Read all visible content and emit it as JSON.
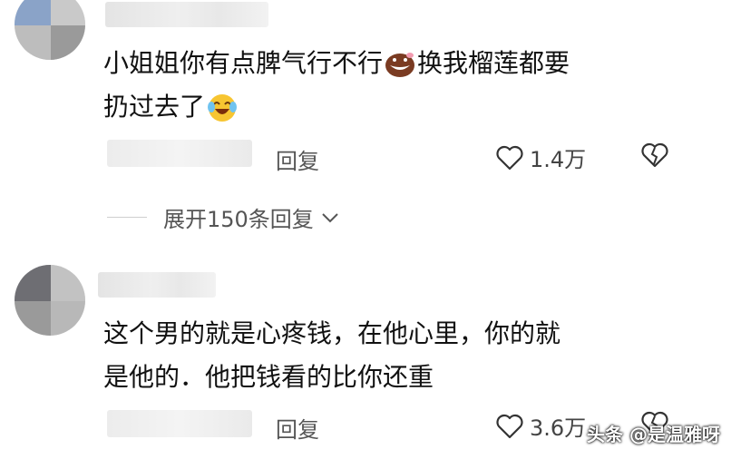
{
  "comments": [
    {
      "line1": "小姐姐你有点脾气行不行",
      "line1b": "换我榴莲都要",
      "line2": "扔过去了",
      "reply_label": "回复",
      "likes": "1.4万"
    },
    {
      "line1": "这个男的就是心疼钱，在他心里，你的就",
      "line2": "是他的．他把钱看的比你还重",
      "reply_label": "回复",
      "likes": "3.6万"
    }
  ],
  "expand_label": "展开150条回复",
  "watermark": "头条 @是温雅呀",
  "icons": [
    "heart-outline-icon",
    "broken-heart-icon",
    "chevron-down-icon",
    "cookie-emoji-icon",
    "laugh-cry-emoji-icon"
  ]
}
